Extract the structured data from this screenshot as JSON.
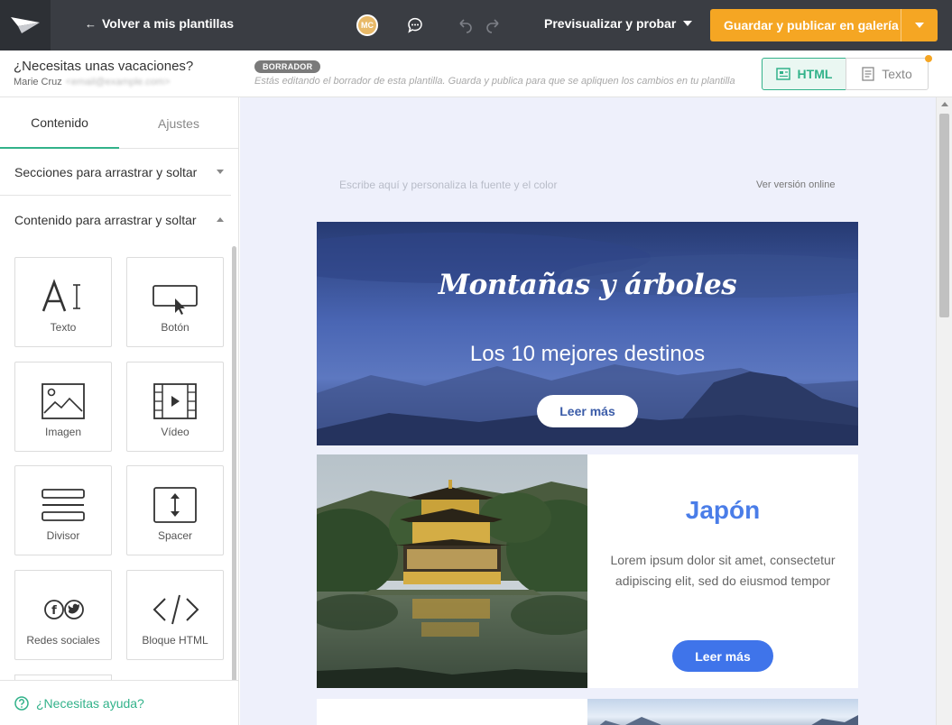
{
  "topbar": {
    "back_label": "Volver a mis plantillas",
    "avatar_initials": "MC",
    "preview_label": "Previsualizar y probar",
    "publish_label": "Guardar y publicar en galería",
    "colors": {
      "bar": "#3a3d43",
      "publish": "#f5a623"
    }
  },
  "subbar": {
    "template_title": "¿Necesitas unas vacaciones?",
    "user_name": "Marie Cruz",
    "user_email": "<email@example.com>",
    "draft_badge": "BORRADOR",
    "draft_note": "Estás editando el borrador de esta plantilla. Guarda y publica para que se apliquen los cambios en tu plantilla",
    "mode_html": "HTML",
    "mode_text": "Texto",
    "accent": "#32b28a"
  },
  "sidebar": {
    "tabs": [
      {
        "label": "Contenido",
        "active": true
      },
      {
        "label": "Ajustes",
        "active": false
      }
    ],
    "section_drag": "Secciones para arrastrar y soltar",
    "content_drag": "Contenido para arrastrar y soltar",
    "blocks": [
      {
        "label": "Texto",
        "icon": "text-icon"
      },
      {
        "label": "Botón",
        "icon": "button-icon"
      },
      {
        "label": "Imagen",
        "icon": "image-icon"
      },
      {
        "label": "Vídeo",
        "icon": "video-icon"
      },
      {
        "label": "Divisor",
        "icon": "divider-icon"
      },
      {
        "label": "Spacer",
        "icon": "spacer-icon"
      },
      {
        "label": "Redes sociales",
        "icon": "social-icon"
      },
      {
        "label": "Bloque HTML",
        "icon": "code-icon"
      }
    ],
    "help_label": "¿Necesitas ayuda?"
  },
  "email": {
    "preheader": "Escribe aquí y personaliza la fuente y el color",
    "view_online": "Ver versión online",
    "hero": {
      "title": "Montañas y árboles",
      "subtitle": "Los 10 mejores destinos",
      "button": "Leer más"
    },
    "card": {
      "title": "Japón",
      "text": "Lorem ipsum dolor sit amet, consectetur adipiscing elit, sed do eiusmod tempor",
      "button": "Leer más",
      "title_color": "#4a7de8",
      "button_color": "#3f74ea"
    }
  }
}
